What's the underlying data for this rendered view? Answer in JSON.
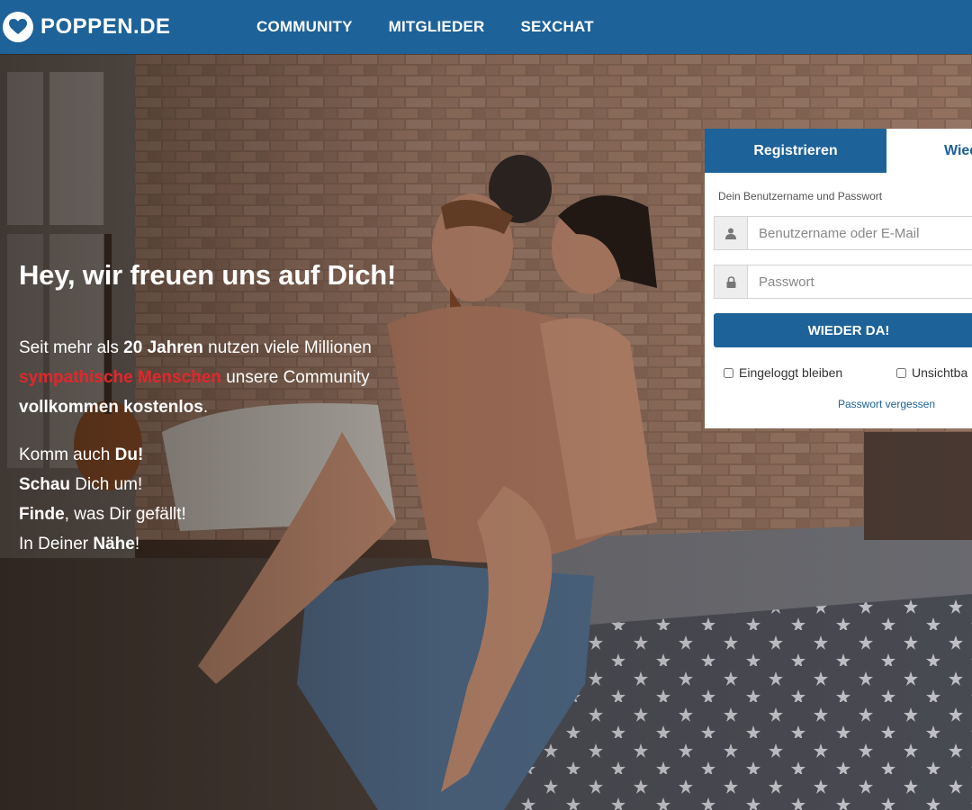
{
  "header": {
    "logo_text": "POPPEN.DE",
    "nav": [
      {
        "label": "COMMUNITY"
      },
      {
        "label": "MITGLIEDER"
      },
      {
        "label": "SEXCHAT"
      }
    ]
  },
  "hero": {
    "headline": "Hey, wir freuen uns auf Dich!",
    "intro": {
      "part1": "Seit mehr als ",
      "bold1": "20 Jahren",
      "part2": " nutzen viele Millionen ",
      "red": "sympathische Menschen",
      "part3": " unsere Community ",
      "bold2": "vollkommen kostenlos",
      "part4": "."
    },
    "lines": [
      {
        "pre": "Komm auch ",
        "bold": "Du!",
        "post": ""
      },
      {
        "pre": "",
        "bold": "Schau",
        "post": " Dich um!"
      },
      {
        "pre": "",
        "bold": "Finde",
        "post": ", was Dir gefällt!"
      },
      {
        "pre": "In Deiner ",
        "bold": "Nähe",
        "post": "!"
      }
    ]
  },
  "login": {
    "tab_register": "Registrieren",
    "tab_login": "Wied",
    "label": "Dein Benutzername und Passwort",
    "username_placeholder": "Benutzername oder E-Mail",
    "password_placeholder": "Passwort",
    "submit": "WIEDER DA!",
    "remember": "Eingeloggt bleiben",
    "invisible": "Unsichtba",
    "forgot": "Passwort vergessen"
  },
  "colors": {
    "brand_blue": "#1d6299",
    "accent_red": "#e0282c"
  },
  "icons": {
    "logo": "heart-logo-icon",
    "username": "user-icon",
    "password": "lock-icon"
  }
}
